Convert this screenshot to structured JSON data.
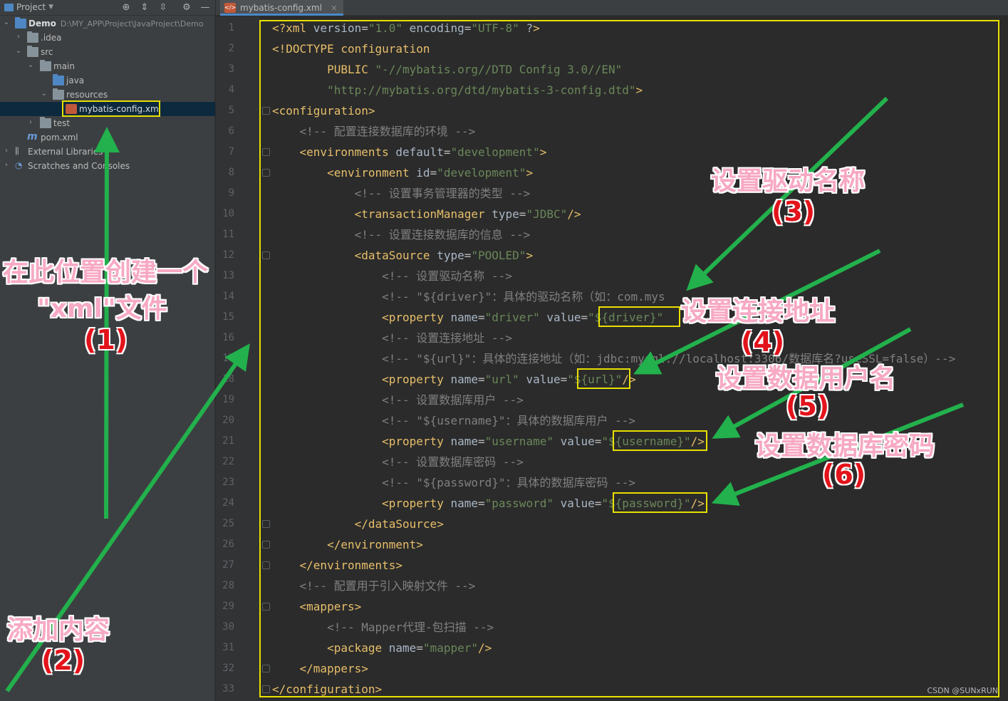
{
  "project_panel": {
    "title": "Project",
    "tree": [
      {
        "label": "Demo",
        "path": "D:\\MY_APP\\Project\\JavaProject\\Demo",
        "icon": "module-folder-icon",
        "expanded": true
      },
      {
        "label": ".idea",
        "icon": "folder-icon",
        "expanded": false
      },
      {
        "label": "src",
        "icon": "folder-icon",
        "expanded": true
      },
      {
        "label": "main",
        "icon": "folder-icon",
        "expanded": true
      },
      {
        "label": "java",
        "icon": "source-folder-icon"
      },
      {
        "label": "resources",
        "icon": "resources-folder-icon",
        "expanded": true
      },
      {
        "label": "mybatis-config.xml",
        "icon": "xml-file-icon",
        "selected": true
      },
      {
        "label": "test",
        "icon": "folder-icon",
        "expanded": false
      },
      {
        "label": "pom.xml",
        "icon": "maven-icon"
      },
      {
        "label": "External Libraries",
        "icon": "libraries-icon",
        "expanded": false
      },
      {
        "label": "Scratches and Consoles",
        "icon": "scratches-icon",
        "expanded": false
      }
    ]
  },
  "editor": {
    "tab_label": "mybatis-config.xml",
    "line_numbers": [
      "1",
      "2",
      "3",
      "4",
      "5",
      "6",
      "7",
      "8",
      "9",
      "10",
      "11",
      "12",
      "13",
      "14",
      "15",
      "16",
      "17",
      "18",
      "19",
      "20",
      "21",
      "22",
      "23",
      "24",
      "25",
      "26",
      "27",
      "28",
      "29",
      "30",
      "31",
      "32",
      "33"
    ],
    "code": {
      "l1": "<?xml version=\"1.0\" encoding=\"UTF-8\" ?>",
      "l2": "<!DOCTYPE configuration",
      "l3": "        PUBLIC \"-//mybatis.org//DTD Config 3.0//EN\"",
      "l4": "        \"http://mybatis.org/dtd/mybatis-3-config.dtd\">",
      "l5": "<configuration>",
      "l6": "    <!-- 配置连接数据库的环境 -->",
      "l7": "    <environments default=\"development\">",
      "l8": "        <environment id=\"development\">",
      "l9": "            <!-- 设置事务管理器的类型 -->",
      "l10": "            <transactionManager type=\"JDBC\"/>",
      "l11": "            <!-- 设置连接数据库的信息 -->",
      "l12": "            <dataSource type=\"POOLED\">",
      "l13": "                <!-- 设置驱动名称 -->",
      "l14": "                <!-- \"${driver}\"：具体的驱动名称（如：com.mys",
      "l15": "                <property name=\"driver\" value=\"${driver}\"",
      "l16": "                <!-- 设置连接地址 -->",
      "l17": "                <!-- \"${url}\"：具体的连接地址（如：jdbc:mysql://localhost:3306/数据库名?useSSL=false）-->",
      "l18": "                <property name=\"url\" value=\"${url}\"/>",
      "l19": "                <!-- 设置数据库用户 -->",
      "l20": "                <!-- \"${username}\"：具体的数据库用户 -->",
      "l21": "                <property name=\"username\" value=\"${username}\"/>",
      "l22": "                <!-- 设置数据库密码 -->",
      "l23": "                <!-- \"${password}\"：具体的数据库密码 -->",
      "l24": "                <property name=\"password\" value=\"${password}\"/>",
      "l25": "            </dataSource>",
      "l26": "        </environment>",
      "l27": "    </environments>",
      "l28": "    <!-- 配置用于引入映射文件 -->",
      "l29": "    <mappers>",
      "l30": "        <!-- Mapper代理-包扫描 -->",
      "l31": "        <package name=\"mapper\"/>",
      "l32": "    </mappers>",
      "l33": "</configuration>"
    }
  },
  "annotations": {
    "a1_line1": "在此位置创建一个",
    "a1_line2": "\"xml\"文件",
    "a1_num": "(1)",
    "a2_text": "添加内容",
    "a2_num": "(2)",
    "a3_text": "设置驱动名称",
    "a3_num": "(3)",
    "a4_text": "设置连接地址",
    "a4_num": "(4)",
    "a5_text": "设置数据用户名",
    "a5_num": "(5)",
    "a6_text": "设置数据库密码",
    "a6_num": "(6)"
  },
  "watermark": "CSDN @SUNxRUN",
  "colors": {
    "highlight_box": "#e8e000",
    "arrow": "#22b14c",
    "annotation_text": "#f7a9c4",
    "annotation_number": "#e3131b",
    "xml_tag": "#e8bf6a",
    "xml_value": "#6a8759",
    "comment": "#808080"
  }
}
